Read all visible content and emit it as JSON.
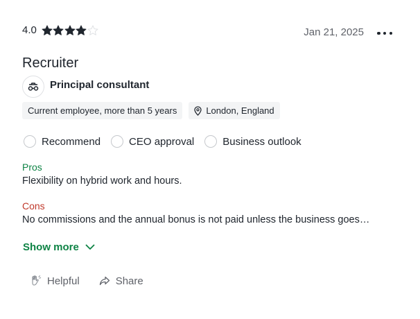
{
  "review": {
    "rating": "4.0",
    "rating_stars": 4,
    "rating_max": 5,
    "date": "Jan 21, 2025",
    "title": "Recruiter",
    "job_title": "Principal consultant",
    "employment": "Current employee, more than 5 years",
    "location": "London, England",
    "recommendations": [
      "Recommend",
      "CEO approval",
      "Business outlook"
    ],
    "pros_label": "Pros",
    "pros_text": "Flexibility on hybrid work and hours.",
    "cons_label": "Cons",
    "cons_text": "No commissions and the annual bonus is not paid unless the business goes…",
    "show_more": "Show more",
    "helpful_label": "Helpful",
    "share_label": "Share"
  },
  "colors": {
    "green": "#0e8345",
    "red": "#c0392b",
    "star_filled": "#20262e",
    "star_empty": "#dfe1e4",
    "text": "#20262e",
    "muted": "#5f6269"
  },
  "icons": {
    "more": "more-horizontal-icon",
    "job": "job-briefcase-icon",
    "location": "location-pin-icon",
    "recommend": "empty-circle-icon",
    "show_more": "chevron-down-icon",
    "helpful": "helpful-hand-icon",
    "share": "share-arrow-icon"
  }
}
